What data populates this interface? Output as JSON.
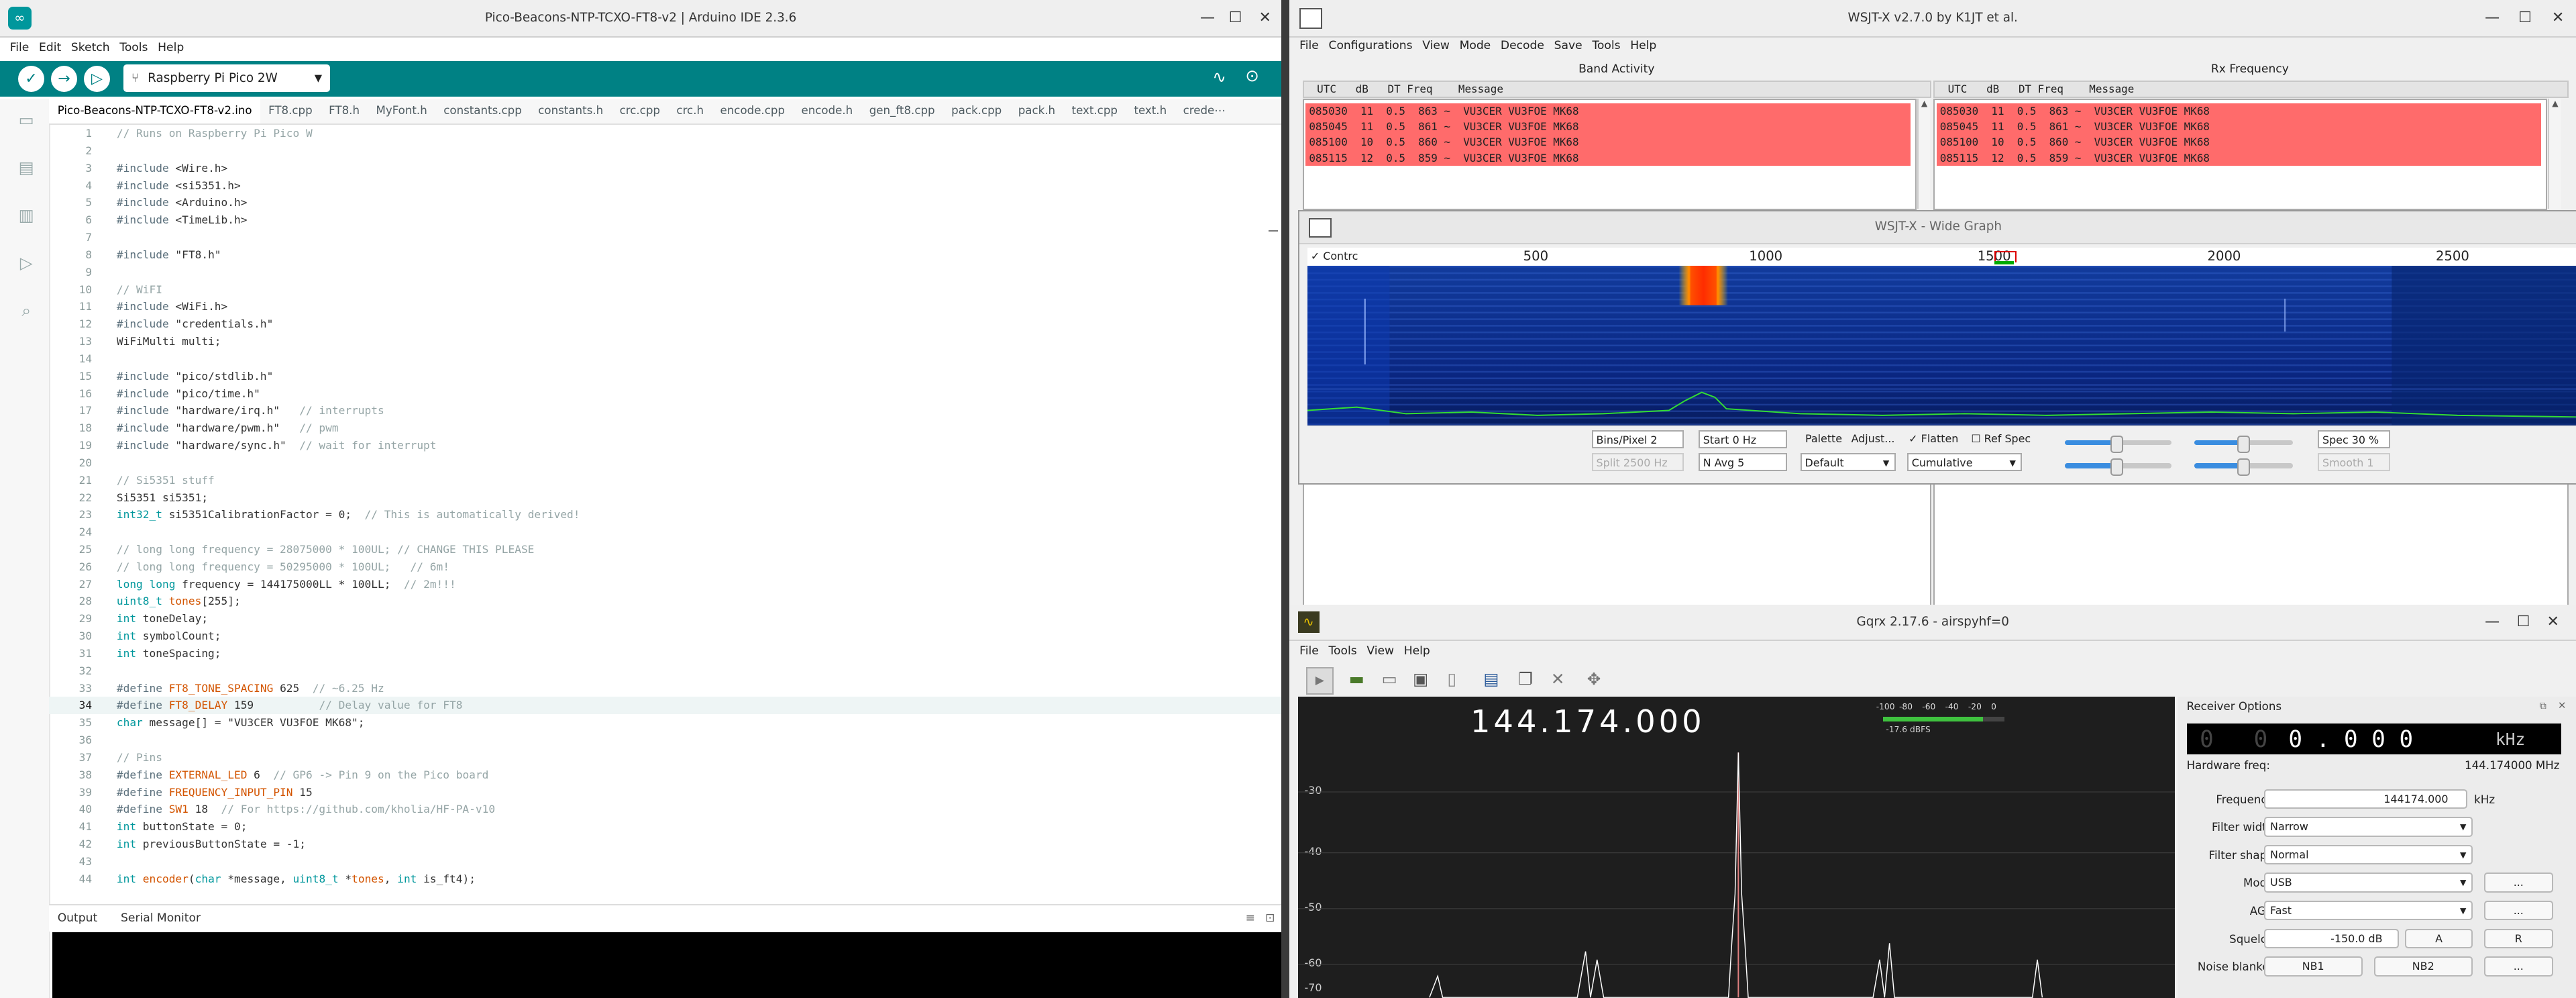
{
  "arduino": {
    "title": "Pico-Beacons-NTP-TCXO-FT8-v2 | Arduino IDE 2.3.6",
    "menu": [
      "File",
      "Edit",
      "Sketch",
      "Tools",
      "Help"
    ],
    "board": "Raspberry Pi Pico 2W",
    "tabs": [
      "Pico-Beacons-NTP-TCXO-FT8-v2.ino",
      "FT8.cpp",
      "FT8.h",
      "MyFont.h",
      "constants.cpp",
      "constants.h",
      "crc.cpp",
      "crc.h",
      "encode.cpp",
      "encode.h",
      "gen_ft8.cpp",
      "pack.cpp",
      "pack.h",
      "text.cpp",
      "text.h",
      "crede⋯"
    ],
    "code_lines": [
      "// Runs on Raspberry Pi Pico W",
      "",
      "#include <Wire.h>",
      "#include <si5351.h>",
      "#include <Arduino.h>",
      "#include <TimeLib.h>",
      "",
      "#include \"FT8.h\"",
      "",
      "// WiFI",
      "#include <WiFi.h>",
      "#include \"credentials.h\"",
      "WiFiMulti multi;",
      "",
      "#include \"pico/stdlib.h\"",
      "#include \"pico/time.h\"",
      "#include \"hardware/irq.h\"   // interrupts",
      "#include \"hardware/pwm.h\"   // pwm",
      "#include \"hardware/sync.h\"  // wait for interrupt",
      "",
      "// Si5351 stuff",
      "Si5351 si5351;",
      "int32_t si5351CalibrationFactor = 0;  // This is automatically derived!",
      "",
      "// long long frequency = 28075000 * 100UL; // CHANGE THIS PLEASE",
      "// long long frequency = 50295000 * 100UL;   // 6m!",
      "long long frequency = 144175000LL * 100LL;  // 2m!!!",
      "uint8_t tones[255];",
      "int toneDelay;",
      "int symbolCount;",
      "int toneSpacing;",
      "",
      "#define FT8_TONE_SPACING 625  // ~6.25 Hz",
      "#define FT8_DELAY 159          // Delay value for FT8",
      "char message[] = \"VU3CER VU3FOE MK68\";",
      "",
      "// Pins",
      "#define EXTERNAL_LED 6  // GP6 -> Pin 9 on the Pico board",
      "#define FREQUENCY_INPUT_PIN 15",
      "#define SW1 18  // For https://github.com/kholia/HF-PA-v10",
      "int buttonState = 0;",
      "int previousButtonState = -1;",
      "",
      "int encoder(char *message, uint8_t *tones, int is_ft4);"
    ],
    "current_line": 34,
    "output_tabs": [
      "Output",
      "Serial Monitor"
    ]
  },
  "wsjt": {
    "title": "WSJT-X   v2.7.0   by K1JT et al.",
    "menu": [
      "File",
      "Configurations",
      "View",
      "Mode",
      "Decode",
      "Save",
      "Tools",
      "Help"
    ],
    "band_activity_title": "Band Activity",
    "rx_frequency_title": "Rx Frequency",
    "column_header": "  UTC   dB   DT Freq    Message",
    "decodes": [
      "085030  11  0.5  863 ~  VU3CER VU3FOE MK68",
      "085045  11  0.5  861 ~  VU3CER VU3FOE MK68",
      "085100  10  0.5  860 ~  VU3CER VU3FOE MK68",
      "085115  12  0.5  859 ~  VU3CER VU3FOE MK68"
    ],
    "decode_color": "#ff6b6b"
  },
  "wide_graph": {
    "title": "WSJT-X - Wide Graph",
    "controls_label": "Contrc",
    "freq_ticks": [
      "500",
      "1000",
      "1500",
      "2000",
      "2500"
    ],
    "bins_per_pixel": "Bins/Pixel  2",
    "start": "Start 0 Hz",
    "palette": "Palette",
    "adjust": "Adjust...",
    "flatten": "Flatten",
    "ref_spec": "Ref Spec",
    "spec": "Spec 30 %",
    "split": "Split  2500  Hz",
    "n_avg": "N Avg 5",
    "palette_value": "Default",
    "mode_value": "Cumulative",
    "smooth": "Smooth  1",
    "flatten_checked": true,
    "ref_spec_checked": false
  },
  "gqrx": {
    "title": "Gqrx 2.17.6 - airspyhf=0",
    "menu": [
      "File",
      "Tools",
      "View",
      "Help"
    ],
    "plot_freq": "144.174.000",
    "smeter_ticks": [
      "-100",
      "-80",
      "-60",
      "-40",
      "-20",
      "0"
    ],
    "smeter_dbfs": "-17.6 dBFS",
    "db_labels": [
      "-30",
      "-40",
      "-50",
      "-60",
      "-70"
    ],
    "receiver_options_title": "Receiver Options",
    "lcd_dim": "0  0",
    "lcd_main": "0 . 0 0 0",
    "lcd_unit": "kHz",
    "hw_freq_label": "Hardware freq:",
    "hw_freq_value": "144.174000 MHz",
    "rows": [
      {
        "label": "Frequency",
        "value": "144174.000",
        "suffix": "kHz"
      },
      {
        "label": "Filter width",
        "value": "Narrow"
      },
      {
        "label": "Filter shape",
        "value": "Normal"
      },
      {
        "label": "Mode",
        "value": "USB",
        "button": "..."
      },
      {
        "label": "AGC",
        "value": "Fast",
        "button": "..."
      },
      {
        "label": "Squelch",
        "value": "-150.0 dB",
        "btn_a": "A",
        "btn_r": "R"
      },
      {
        "label": "Noise blanker",
        "nb1": "NB1",
        "nb2": "NB2",
        "button": "..."
      }
    ]
  }
}
